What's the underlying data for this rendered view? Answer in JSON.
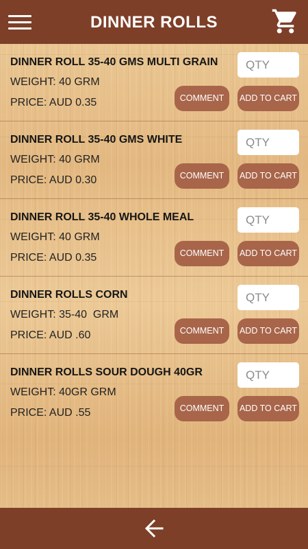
{
  "header": {
    "title": "DINNER ROLLS",
    "menu_icon": "hamburger-menu-icon",
    "cart_icon": "shopping-cart-icon"
  },
  "colors": {
    "bar": "#7d3f28",
    "button": "#a8654a",
    "button_text": "#ffffff"
  },
  "products": [
    {
      "name": "DINNER ROLL 35-40 GMS MULTI GRAIN",
      "weight": "WEIGHT: 40 GRM",
      "price": "PRICE: AUD 0.35",
      "qty_placeholder": "QTY",
      "comment_label": "COMMENT",
      "add_label": "ADD TO CART"
    },
    {
      "name": "DINNER ROLL 35-40 GMS WHITE",
      "weight": "WEIGHT: 40 GRM",
      "price": "PRICE: AUD 0.30",
      "qty_placeholder": "QTY",
      "comment_label": "COMMENT",
      "add_label": "ADD TO CART"
    },
    {
      "name": "DINNER ROLL 35-40 WHOLE MEAL",
      "weight": "WEIGHT: 40 GRM",
      "price": "PRICE: AUD 0.35",
      "qty_placeholder": "QTY",
      "comment_label": "COMMENT",
      "add_label": "ADD TO CART"
    },
    {
      "name": "DINNER ROLLS CORN",
      "weight": "WEIGHT: 35-40  GRM",
      "price": "PRICE: AUD .60",
      "qty_placeholder": "QTY",
      "comment_label": "COMMENT",
      "add_label": "ADD TO CART"
    },
    {
      "name": "DINNER ROLLS SOUR DOUGH 40GR",
      "weight": "WEIGHT: 40GR GRM",
      "price": "PRICE: AUD .55",
      "qty_placeholder": "QTY",
      "comment_label": "COMMENT",
      "add_label": "ADD TO CART"
    }
  ],
  "footer": {
    "back_icon": "back-arrow-icon"
  }
}
